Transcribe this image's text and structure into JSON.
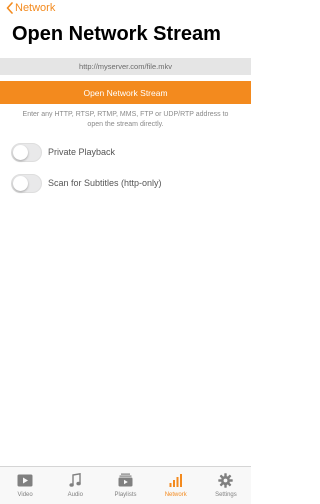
{
  "nav": {
    "back_label": "Network"
  },
  "page": {
    "title": "Open Network Stream"
  },
  "url_field": {
    "placeholder": "http://myserver.com/file.mkv",
    "value": ""
  },
  "open_button": {
    "label": "Open Network Stream"
  },
  "help_text": "Enter any HTTP, RTSP, RTMP, MMS, FTP or UDP/RTP address to\nopen the stream directly.",
  "toggles": [
    {
      "label": "Private Playback",
      "on": false
    },
    {
      "label": "Scan for Subtitles (http-only)",
      "on": false
    }
  ],
  "tab_bar": {
    "tabs": [
      {
        "label": "Video",
        "icon": "video-icon",
        "active": false
      },
      {
        "label": "Audio",
        "icon": "music-note-icon",
        "active": false
      },
      {
        "label": "Playlists",
        "icon": "playlist-icon",
        "active": false
      },
      {
        "label": "Network",
        "icon": "network-bars-icon",
        "active": true
      },
      {
        "label": "Settings",
        "icon": "gear-icon",
        "active": false
      }
    ]
  },
  "colors": {
    "accent": "#f38a1e",
    "field_background": "#e5e5e5",
    "inactive_tab": "#808080"
  }
}
